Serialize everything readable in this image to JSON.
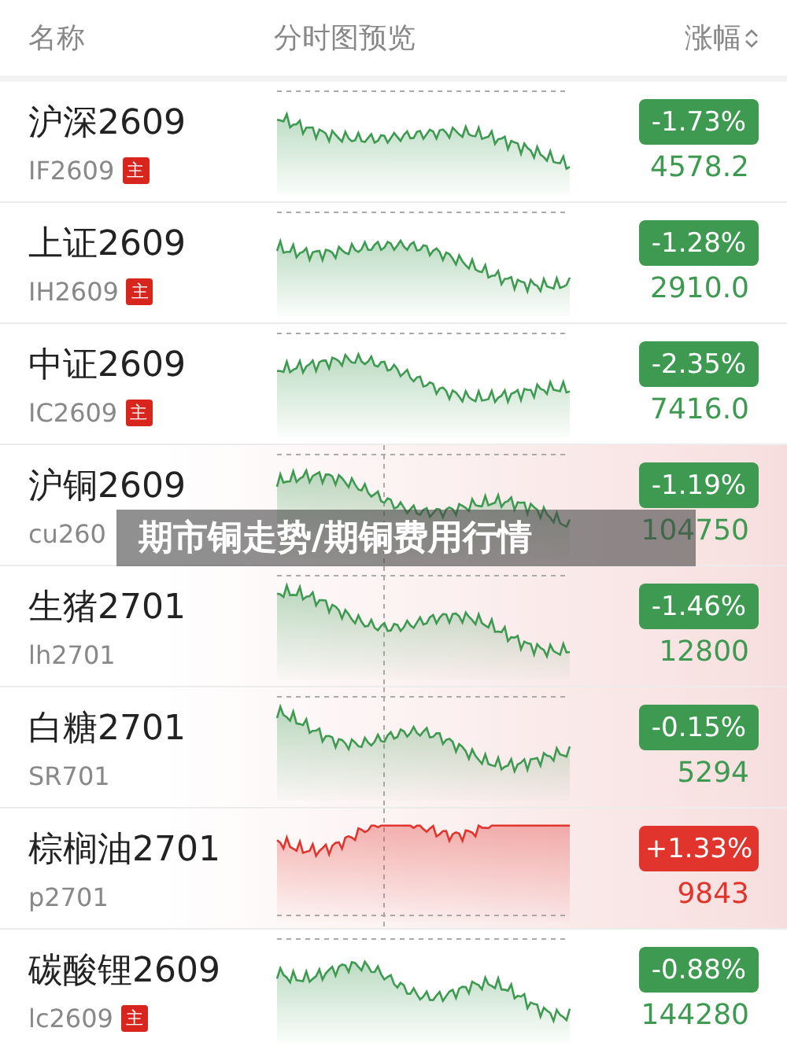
{
  "header": {
    "name": "名称",
    "chart": "分时图预览",
    "change": "涨幅"
  },
  "rows": [
    {
      "name": "沪深2609",
      "code": "IF2609",
      "badge": "主",
      "kind": "down",
      "highlighted": false,
      "change": "-1.73%",
      "price": "4578.2"
    },
    {
      "name": "上证2609",
      "code": "IH2609",
      "badge": "主",
      "kind": "down",
      "highlighted": false,
      "change": "-1.28%",
      "price": "2910.0"
    },
    {
      "name": "中证2609",
      "code": "IC2609",
      "badge": "主",
      "kind": "down",
      "highlighted": false,
      "change": "-2.35%",
      "price": "7416.0"
    },
    {
      "name": "沪铜2609",
      "code": "cu260",
      "kind": "down",
      "highlighted": true,
      "change": "-1.19%",
      "price": "104750"
    },
    {
      "name": "生猪2701",
      "code": "lh2701",
      "kind": "down",
      "highlighted": true,
      "change": "-1.46%",
      "price": "12800"
    },
    {
      "name": "白糖2701",
      "code": "SR701",
      "kind": "down",
      "highlighted": true,
      "change": "-0.15%",
      "price": "5294"
    },
    {
      "name": "棕榈油2701",
      "code": "p2701",
      "kind": "up",
      "highlighted": true,
      "change": "+1.33%",
      "price": "9843"
    },
    {
      "name": "碳酸锂2609",
      "code": "lc2609",
      "badge": "主",
      "kind": "down",
      "highlighted": false,
      "change": "-0.88%",
      "price": "144280"
    }
  ],
  "banner": "期市铜走势/期铜费用行情"
}
